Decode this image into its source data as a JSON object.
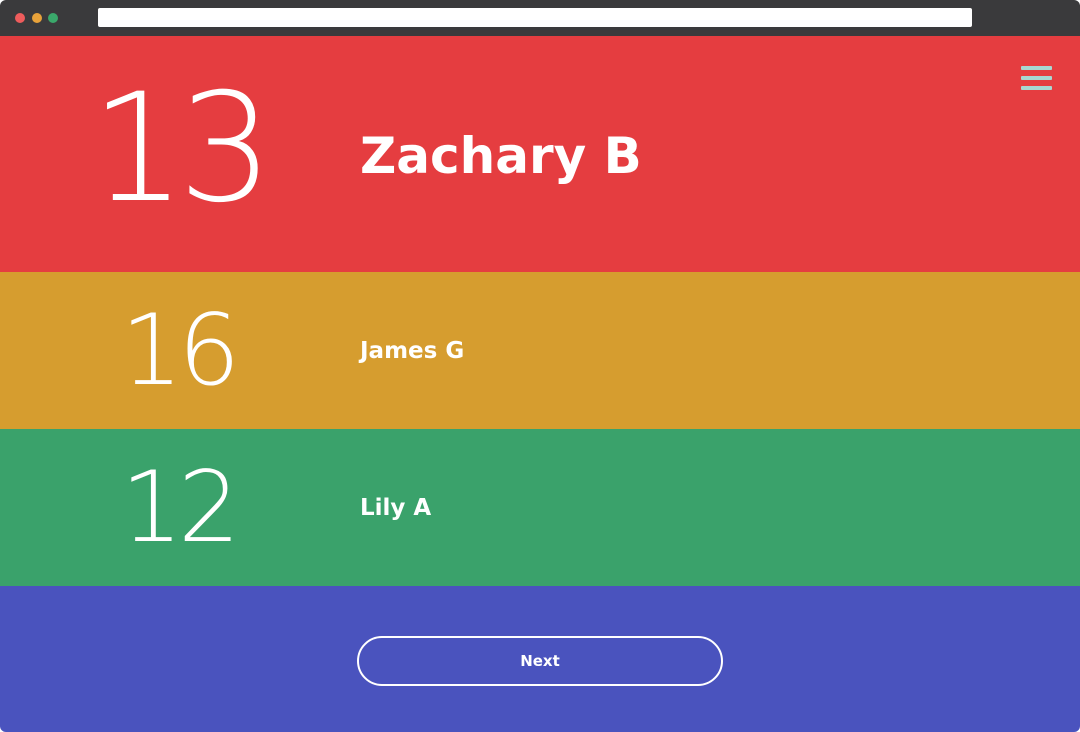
{
  "browser": {
    "dots": {
      "red": "#ee5c5c",
      "yellow": "#e8a23a",
      "green": "#3aa86b"
    },
    "url": ""
  },
  "menu": {
    "icon": "hamburger-menu-icon",
    "color": "#a8d8d2"
  },
  "rows": [
    {
      "number": "13",
      "name": "Zachary B",
      "color": "#e53d40"
    },
    {
      "number": "16",
      "name": "James G",
      "color": "#d69d2f"
    },
    {
      "number": "12",
      "name": "Lily A",
      "color": "#3aa26b"
    }
  ],
  "footer": {
    "color": "#4a53be",
    "next_label": "Next"
  }
}
